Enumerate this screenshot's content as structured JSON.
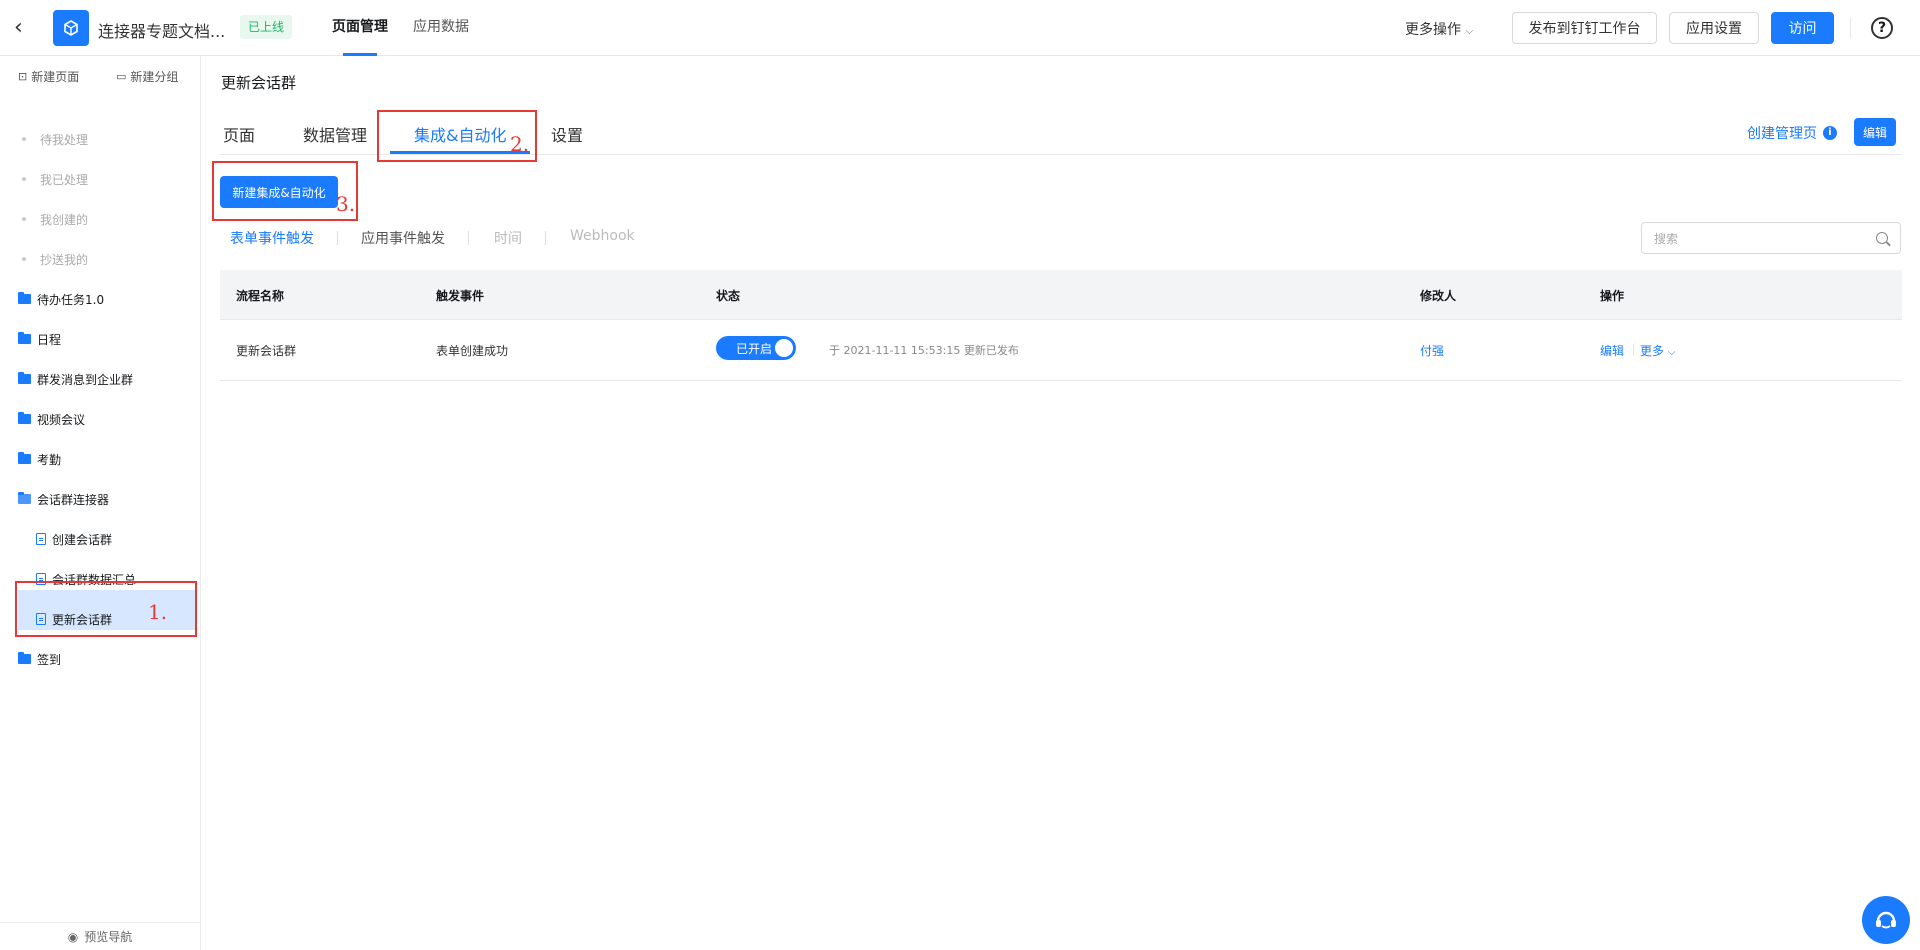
{
  "topbar": {
    "app_name": "连接器专题文档...",
    "status_badge": "已上线",
    "nav_tabs": [
      "页面管理",
      "应用数据"
    ],
    "more_actions": "更多操作",
    "publish_btn": "发布到钉钉工作台",
    "settings_btn": "应用设置",
    "visit_btn": "访问",
    "help": "?"
  },
  "sidebar": {
    "new_page": "新建页面",
    "new_group": "新建分组",
    "dim_items": [
      "待我处理",
      "我已处理",
      "我创建的",
      "抄送我的"
    ],
    "folders": [
      "待办任务1.0",
      "日程",
      "群发消息到企业群",
      "视频会议",
      "考勤",
      "会话群连接器"
    ],
    "children": [
      "创建会话群",
      "会话群数据汇总",
      "更新会话群"
    ],
    "last_folder": "签到",
    "preview_nav": "预览导航"
  },
  "main": {
    "page_title": "更新会话群",
    "tabs": [
      "页面",
      "数据管理",
      "集成&自动化",
      "设置"
    ],
    "create_admin": "创建管理页",
    "edit_btn": "编辑",
    "new_auto_btn": "新建集成&自动化",
    "subtabs": [
      "表单事件触发",
      "应用事件触发",
      "时间",
      "Webhook"
    ],
    "search_placeholder": "搜索",
    "table": {
      "headers": [
        "流程名称",
        "触发事件",
        "状态",
        "修改人",
        "操作"
      ],
      "rows": [
        {
          "name": "更新会话群",
          "event": "表单创建成功",
          "status": "已开启",
          "meta": "于 2021-11-11 15:53:15 更新已发布",
          "modifier": "付强",
          "op_edit": "编辑",
          "op_more": "更多"
        }
      ]
    }
  },
  "annotations": [
    "1.",
    "2.",
    "3."
  ],
  "colors": {
    "primary": "#1a7bff",
    "annotation": "#e53935",
    "online": "#1fb36a"
  }
}
